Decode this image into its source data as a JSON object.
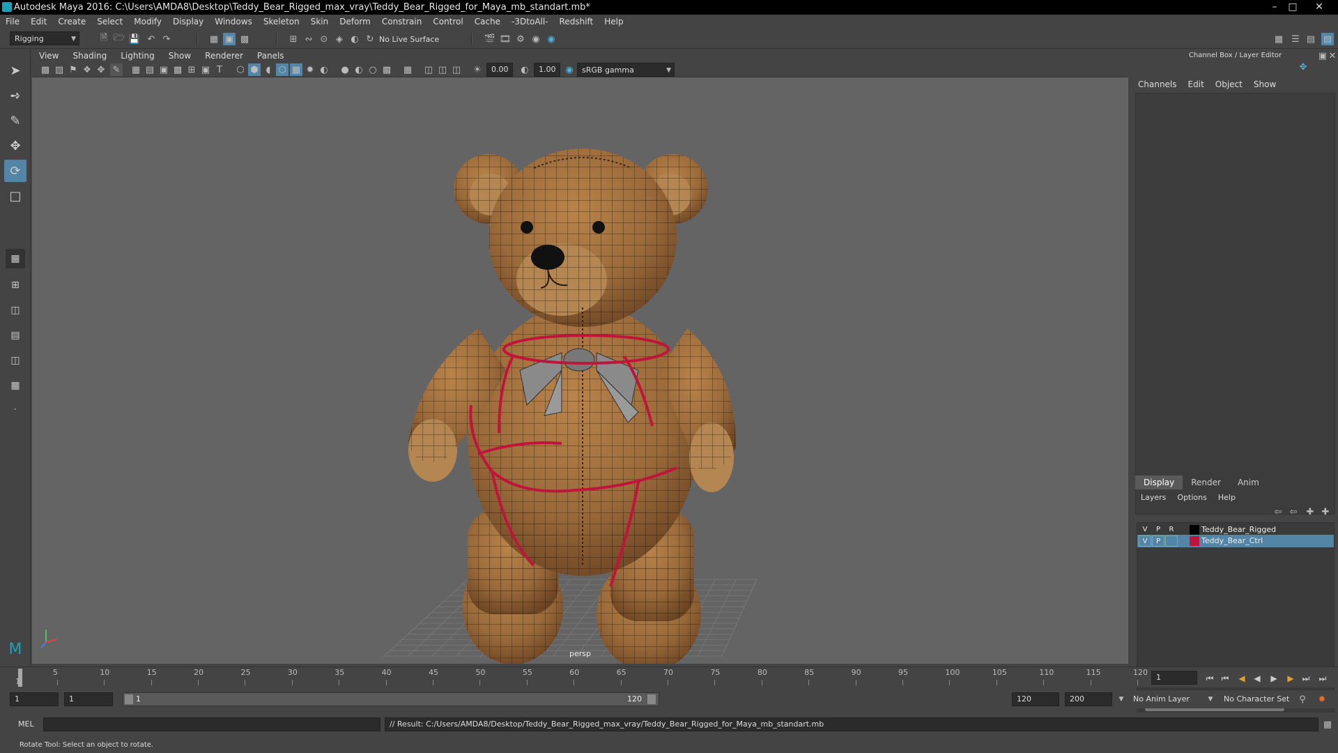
{
  "window": {
    "title": "Autodesk Maya 2016: C:\\Users\\AMDA8\\Desktop\\Teddy_Bear_Rigged_max_vray\\Teddy_Bear_Rigged_for_Maya_mb_standart.mb*"
  },
  "menubar": [
    "File",
    "Edit",
    "Create",
    "Select",
    "Modify",
    "Display",
    "Windows",
    "Skeleton",
    "Skin",
    "Deform",
    "Constrain",
    "Control",
    "Cache",
    "-3DtoAll-",
    "Redshift",
    "Help"
  ],
  "shelf": {
    "mode_menu": "Rigging",
    "live_surface": "No Live Surface"
  },
  "viewport": {
    "menu": [
      "View",
      "Shading",
      "Lighting",
      "Show",
      "Renderer",
      "Panels"
    ],
    "exposure": "0.00",
    "gamma": "1.00",
    "color_space": "sRGB gamma",
    "camera_label": "persp"
  },
  "channel_box": {
    "title": "Channel Box / Layer Editor",
    "menu": [
      "Channels",
      "Edit",
      "Object",
      "Show"
    ]
  },
  "layer_editor": {
    "tabs": [
      "Display",
      "Render",
      "Anim"
    ],
    "active_tab": "Display",
    "menu": [
      "Layers",
      "Options",
      "Help"
    ],
    "layers": [
      {
        "v": "V",
        "p": "P",
        "r": "R",
        "name": "Teddy_Bear_Rigged",
        "color": "#000000",
        "selected": false
      },
      {
        "v": "V",
        "p": "P",
        "r": "",
        "name": "Teddy_Bear_Ctrl",
        "color": "#c0143c",
        "selected": true
      }
    ]
  },
  "timeline": {
    "ticks": [
      "1",
      "5",
      "10",
      "15",
      "20",
      "25",
      "30",
      "35",
      "40",
      "45",
      "50",
      "55",
      "60",
      "65",
      "70",
      "75",
      "80",
      "85",
      "90",
      "95",
      "100",
      "105",
      "110",
      "115",
      "120"
    ],
    "current_frame": "1"
  },
  "range": {
    "start": "1",
    "playback_start": "1",
    "slider_start": "1",
    "slider_end": "120",
    "playback_end": "120",
    "end": "200",
    "anim_layer": "No Anim Layer",
    "character_set": "No Character Set"
  },
  "command": {
    "language": "MEL",
    "result": "// Result: C:/Users/AMDA8/Desktop/Teddy_Bear_Rigged_max_vray/Teddy_Bear_Rigged_for_Maya_mb_standart.mb"
  },
  "help_line": "Rotate Tool: Select an object to rotate.",
  "colors": {
    "selection_blue": "#5285a6",
    "rig_control_red": "#c0143c",
    "viewport_bg": "#646464",
    "bear_fur": "#9a6a3a"
  }
}
